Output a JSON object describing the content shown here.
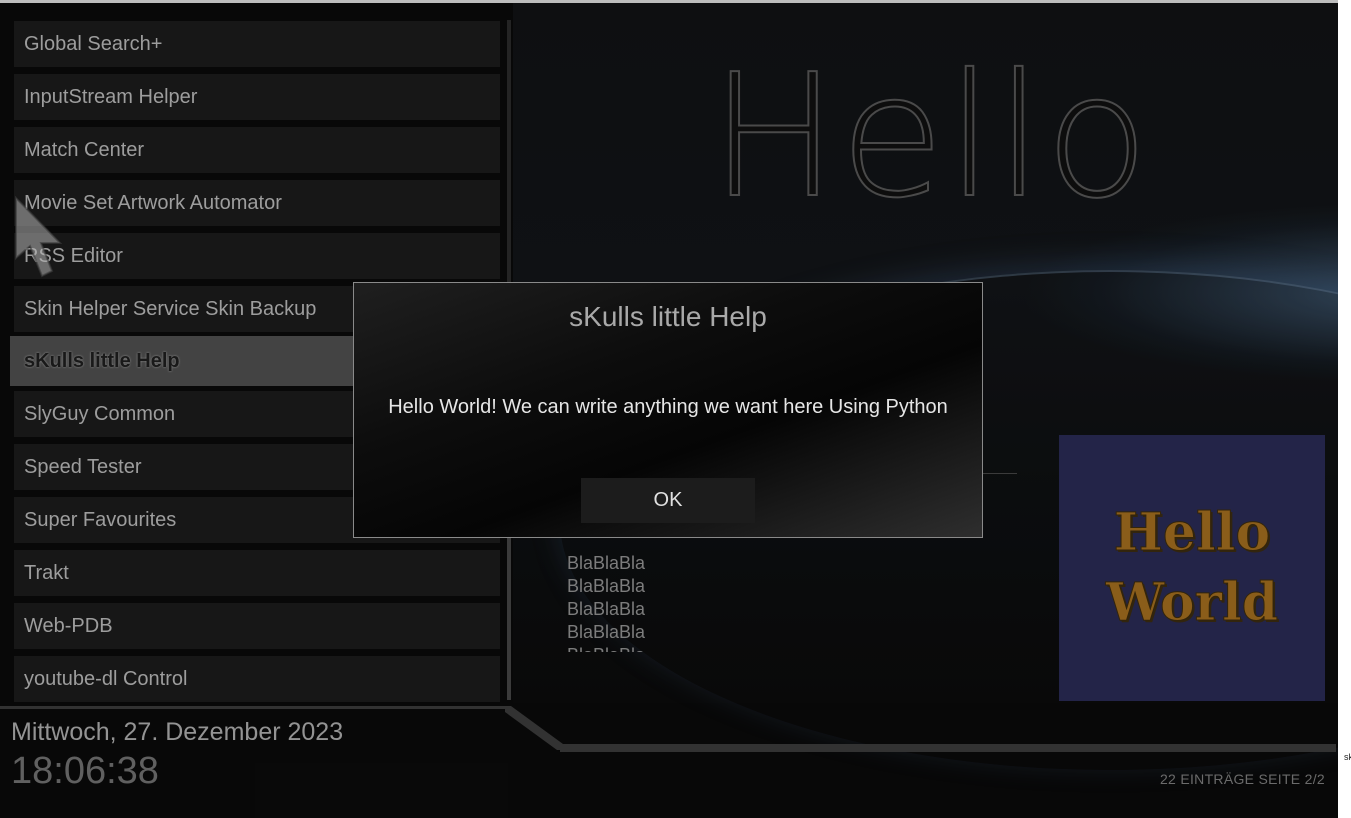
{
  "addons": {
    "items": [
      {
        "label": "Global Search+"
      },
      {
        "label": "InputStream Helper"
      },
      {
        "label": "Match Center"
      },
      {
        "label": "Movie Set Artwork Automator"
      },
      {
        "label": "RSS Editor"
      },
      {
        "label": "Skin Helper Service Skin Backup"
      },
      {
        "label": "sKulls little Help",
        "selected": true
      },
      {
        "label": "SlyGuy Common"
      },
      {
        "label": "Speed Tester"
      },
      {
        "label": "Super Favourites"
      },
      {
        "label": "Trakt"
      },
      {
        "label": "Web-PDB"
      },
      {
        "label": "youtube-dl Control"
      }
    ]
  },
  "preview": {
    "title": "Hello",
    "blabla": [
      "BlaBlaBla",
      "BlaBlaBla",
      "BlaBlaBla",
      "BlaBlaBla",
      "BlaBlaBla"
    ],
    "poster": {
      "line1": "Hello",
      "line2": "World"
    }
  },
  "footer": {
    "date": "Mittwoch, 27. Dezember 2023",
    "time": "18:06:38",
    "page_info": "22 EINTRÄGE SEITE 2/2",
    "edge_label": "sk"
  },
  "dialog": {
    "title": "sKulls little Help",
    "message": "Hello World! We can write anything we want here Using Python",
    "ok_label": "OK"
  },
  "colors": {
    "selected_bg": "#4d4d4d",
    "item_bg": "#1b1b1b",
    "poster_bg": "#282a52",
    "poster_text": "#9e6a1e"
  },
  "icons": {
    "cursor": "mouse-pointer-icon"
  }
}
